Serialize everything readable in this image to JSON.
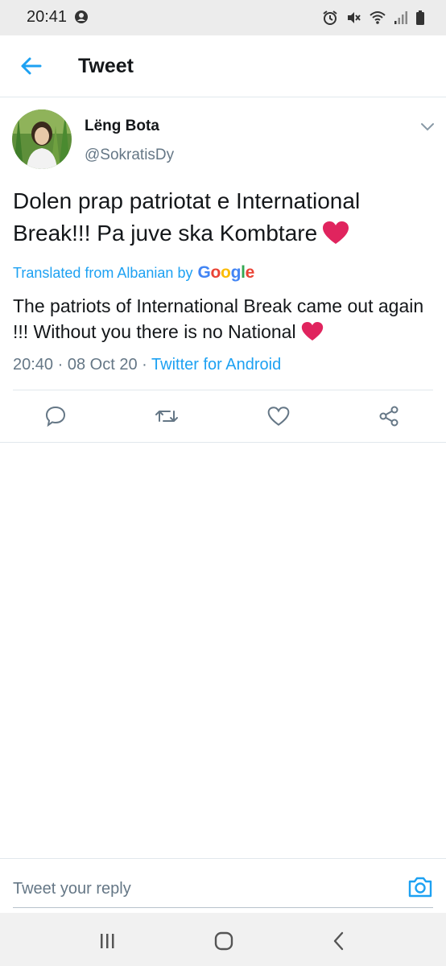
{
  "status_bar": {
    "time": "20:41",
    "icons": [
      "account-circle-icon",
      "alarm-icon",
      "mute-icon",
      "wifi-icon",
      "signal-icon",
      "battery-icon"
    ]
  },
  "header": {
    "back_icon": "arrow-left-icon",
    "title": "Tweet"
  },
  "tweet": {
    "author_name": "Lëng Bota",
    "author_handle": "@SokratisDy",
    "text": "Dolen prap patriotat e International Break!!! Pa juve ska Kombtare",
    "translated_label": "Translated from Albanian by",
    "translation_provider": "Google",
    "translation": "The patriots of International Break came out again !!! Without you there is no National",
    "time": "20:40",
    "date": "08 Oct 20",
    "client": "Twitter for Android",
    "separator": "·",
    "emoji": "red-heart-icon"
  },
  "actions": [
    {
      "icon": "reply-icon"
    },
    {
      "icon": "retweet-icon"
    },
    {
      "icon": "like-icon"
    },
    {
      "icon": "share-icon"
    }
  ],
  "reply": {
    "placeholder": "Tweet your reply",
    "camera_icon": "camera-icon"
  },
  "nav": [
    "recent-apps-icon",
    "home-icon",
    "back-icon"
  ],
  "colors": {
    "accent": "#1da1f2",
    "text": "#14171a",
    "muted": "#657786",
    "heart": "#e0245e",
    "status_bar_bg": "#ececec",
    "nav_bar_bg": "#f1f1f1"
  }
}
